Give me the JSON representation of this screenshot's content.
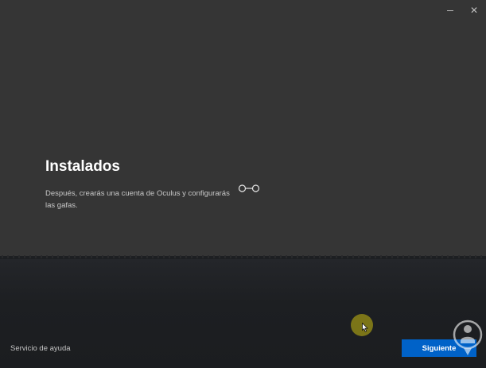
{
  "window": {
    "minimize_glyph": "–",
    "close_glyph": "✕"
  },
  "main": {
    "title": "Instalados",
    "description": "Después, crearás una cuenta de Oculus y configurarás las gafas.",
    "connection_icon": "linked-circles-icon"
  },
  "footer": {
    "help_label": "Servicio de ayuda",
    "next_label": "Siguiente"
  },
  "colors": {
    "accent": "#0062c8",
    "top_background": "#353535",
    "bottom_background": "#1d1f22",
    "cursor_highlight": "#a89f14"
  }
}
